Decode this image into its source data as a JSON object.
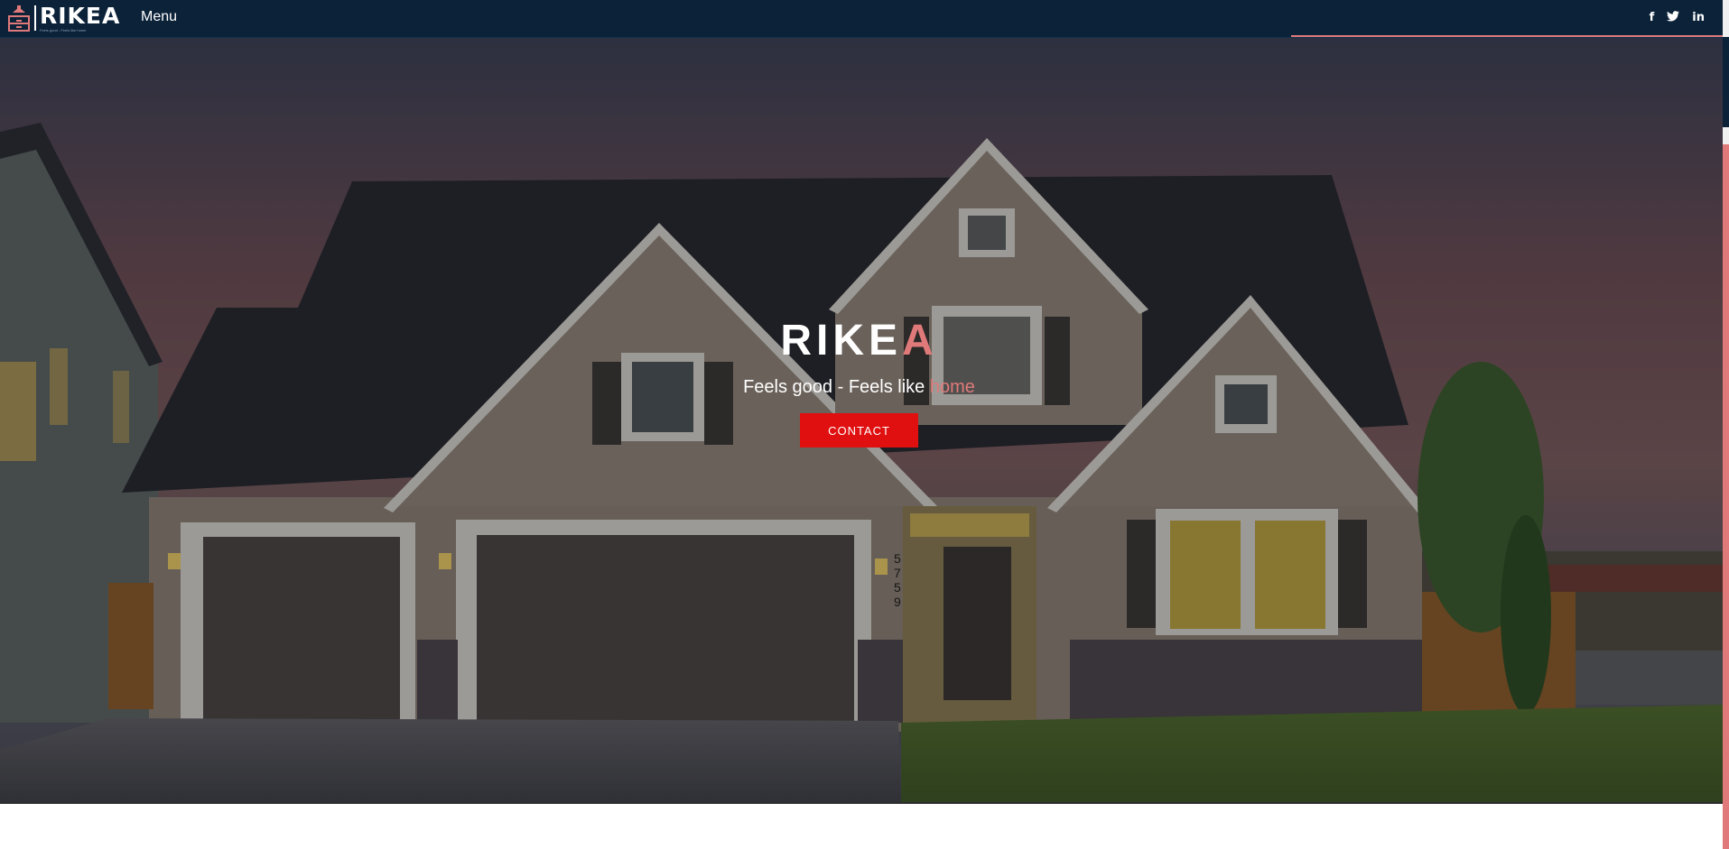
{
  "nav": {
    "brand_name": "RIKEA",
    "brand_tagline": "Feels good - Feels like home",
    "menu_label": "Menu",
    "social": [
      {
        "icon": "facebook-icon",
        "glyph": "f"
      },
      {
        "icon": "twitter-icon",
        "glyph": "🐦"
      },
      {
        "icon": "linkedin-icon",
        "glyph": "in"
      }
    ]
  },
  "hero": {
    "title_main": "RIKE",
    "title_accent": "A",
    "subtitle_main": "Feels good - Feels like ",
    "subtitle_accent": "home",
    "cta_label": "CONTACT",
    "house_number": "5759"
  },
  "colors": {
    "nav_bg": "#0b2239",
    "accent": "#e07a7a",
    "cta_bg": "#e01010"
  }
}
